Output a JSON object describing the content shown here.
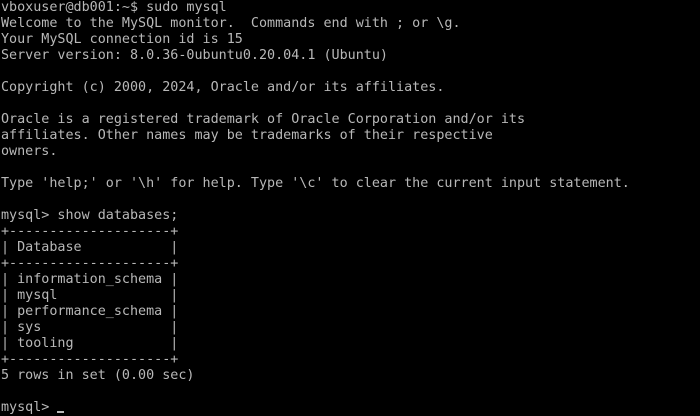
{
  "colors": {
    "background": "#000000",
    "foreground": "#b8b8b8"
  },
  "terminal": {
    "command_prompt": "vboxuser@db001:~$ sudo mysql",
    "welcome": "Welcome to the MySQL monitor.  Commands end with ; or \\g.",
    "connection_id": "Your MySQL connection id is 15",
    "server_version": "Server version: 8.0.36-0ubuntu0.20.04.1 (Ubuntu)",
    "copyright": "Copyright (c) 2000, 2024, Oracle and/or its affiliates.",
    "trademark_1": "Oracle is a registered trademark of Oracle Corporation and/or its",
    "trademark_2": "affiliates. Other names may be trademarks of their respective",
    "trademark_3": "owners.",
    "help_text": "Type 'help;' or '\\h' for help. Type '\\c' to clear the current input statement.",
    "query": "mysql> show databases;",
    "table_border": "+--------------------+",
    "table_header": "| Database           |",
    "rows": [
      "| information_schema |",
      "| mysql              |",
      "| performance_schema |",
      "| sys                |",
      "| tooling            |"
    ],
    "result_summary": "5 rows in set (0.00 sec)",
    "final_prompt": "mysql> "
  }
}
